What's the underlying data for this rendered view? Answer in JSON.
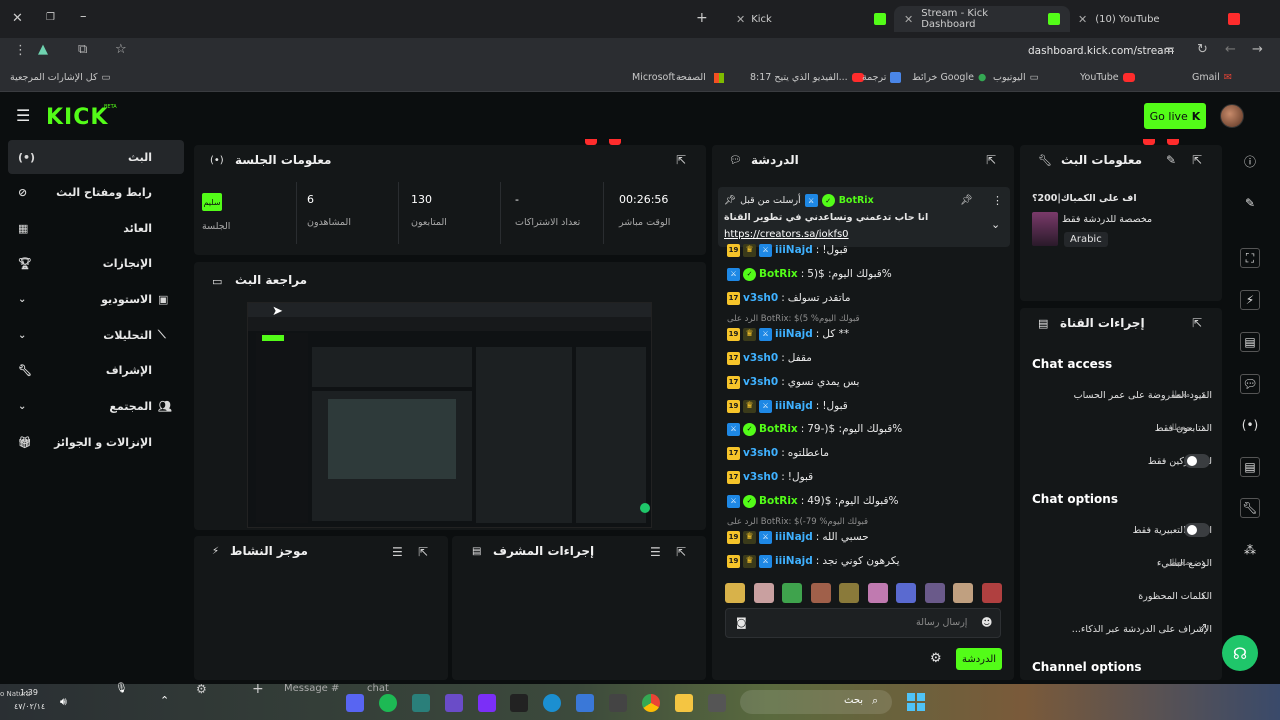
{
  "browser": {
    "tabs": [
      {
        "title": "Kick",
        "active": false
      },
      {
        "title": "Stream - Kick Dashboard",
        "active": true
      },
      {
        "title": "(10) YouTube",
        "active": false
      }
    ],
    "url": "dashboard.kick.com/stream",
    "bookmarks_folder": "كل الإشارات المرجعية",
    "bookmarks": [
      "Gmail",
      "YouTube",
      "اليوتيوب",
      "خرائط Google",
      "ترجمة",
      "8:17 الفيديو الذي يتيح...",
      "الصفحة",
      "Microsoft –"
    ]
  },
  "header": {
    "logo": "KICK",
    "logo_badge": "BETA",
    "go_live": "Go live"
  },
  "sidebar": {
    "items": [
      {
        "label": "البث",
        "active": true
      },
      {
        "label": "رابط ومفتاح البث",
        "active": false
      },
      {
        "label": "العائد",
        "active": false
      },
      {
        "label": "الإنجازات",
        "active": false
      },
      {
        "label": "الاستوديو",
        "active": false
      },
      {
        "label": "التحليلات",
        "active": false
      },
      {
        "label": "الإشراف",
        "active": false
      },
      {
        "label": "المجتمع",
        "active": false
      },
      {
        "label": "الإنزالات و الجوائز",
        "active": false
      }
    ]
  },
  "session": {
    "title": "معلومات الجلسة",
    "stats": [
      {
        "value": "00:26:56",
        "label": "الوقت مباشر"
      },
      {
        "value": "-",
        "label": "تعداد الاشتراكات"
      },
      {
        "value": "130",
        "label": "المتابعون"
      },
      {
        "value": "6",
        "label": "المشاهدون"
      },
      {
        "value": "سليم",
        "label": "الجلسة"
      }
    ]
  },
  "preview": {
    "title": "مراجعة البث"
  },
  "activity": {
    "title": "موجز النشاط"
  },
  "modactions": {
    "title": "إجراءات المشرف"
  },
  "chat": {
    "title": "الدردشة",
    "pinned": {
      "pinned_by": "أرسلت من قبل",
      "user": "BotRix",
      "text": "انا حاب تدعمني وتساعدني في تطوير القناة",
      "link": "https://creators.sa/iokfs0"
    },
    "messages": [
      {
        "user": "iiiNajd",
        "text": "قبول!",
        "badges": "sub-crown-bot",
        "sub": "19"
      },
      {
        "user": "BotRix",
        "text": "%قبولك اليوم: $(5",
        "badges": "bot-ver"
      },
      {
        "user": "v3sh0",
        "text": "ماتقدر تسولف",
        "badges": "sub",
        "sub": "17"
      },
      {
        "user": "iiiNajd",
        "text": "** كل",
        "badges": "sub-crown-bot",
        "sub": "19",
        "reply": "الرد على BotRix: $(5 %قبولك اليوم"
      },
      {
        "user": "v3sh0",
        "text": "مقفل",
        "badges": "sub",
        "sub": "17"
      },
      {
        "user": "v3sh0",
        "text": "بس يمدي نسوي",
        "badges": "sub",
        "sub": "17"
      },
      {
        "user": "iiiNajd",
        "text": "قبول!",
        "badges": "sub-crown-bot",
        "sub": "19"
      },
      {
        "user": "BotRix",
        "text": "%قبولك اليوم: $(-79",
        "badges": "bot-ver"
      },
      {
        "user": "v3sh0",
        "text": "ماعطلتوه",
        "badges": "sub",
        "sub": "17"
      },
      {
        "user": "v3sh0",
        "text": "قبول!",
        "badges": "sub",
        "sub": "17"
      },
      {
        "user": "BotRix",
        "text": "%قبولك اليوم: $(49",
        "badges": "bot-ver"
      },
      {
        "user": "iiiNajd",
        "text": "حسبي الله",
        "badges": "sub-crown-bot",
        "sub": "19",
        "reply": "الرد على BotRix: $(-79 %قبولك اليوم"
      },
      {
        "user": "iiiNajd",
        "text": "يكرهون كوني نجد",
        "badges": "sub-crown-bot",
        "sub": "19"
      }
    ],
    "input_placeholder": "إرسال رسالة",
    "send_label": "الدردشة"
  },
  "stream_info": {
    "title": "معلومات البث",
    "stream_title": "اف على الكمباك|200؟",
    "category": "مخصصة للدردشة فقط",
    "language": "Arabic"
  },
  "channel_actions": {
    "title": "إجراءات القناة",
    "chat_access_heading": "Chat access",
    "chat_access": [
      {
        "label": "القيود المفروضة على عمر الحساب",
        "state": "معطل",
        "control": "chevron"
      },
      {
        "label": "المتابعون فقط",
        "state": "معطل",
        "control": "chevron"
      },
      {
        "label": "للمشتركين فقط",
        "state": "",
        "control": "toggle"
      }
    ],
    "chat_options_heading": "Chat options",
    "chat_options": [
      {
        "label": "الصور التعبيرية فقط",
        "state": "",
        "control": "toggle"
      },
      {
        "label": "الوضع البطيء",
        "state": "معطل",
        "control": "chevron"
      },
      {
        "label": "الكلمات المحظورة",
        "state": "",
        "control": "chevron"
      },
      {
        "label": "الإشراف على الدردشة عبر الذكاء...",
        "state": "",
        "control": "external"
      }
    ],
    "channel_options_heading": "Channel options"
  },
  "taskbar": {
    "search_label": "بحث",
    "message_placeholder": "Message #",
    "chat_label": "chat",
    "clock_time": "1:39",
    "clock_date": "٤٧/٠٢/١٤",
    "user_fragment": "o Naturb"
  },
  "colors": {
    "accent": "#53fc18",
    "bg": "#0b0e0f",
    "panel": "#141718"
  }
}
